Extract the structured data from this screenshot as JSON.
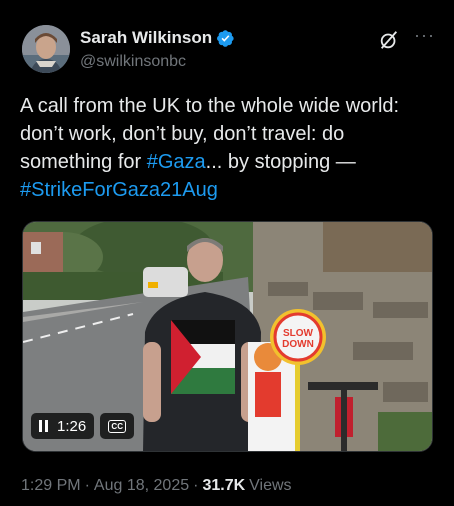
{
  "author": {
    "name": "Sarah Wilkinson",
    "handle": "@swilkinsonbc",
    "verified_color": "#1d9bf0"
  },
  "icons": {
    "grok": "grok-slash-icon",
    "more": "more-dots-icon"
  },
  "more_label": "···",
  "tweet": {
    "text_1": "A call from the UK to the whole wide world: don’t work, don’t buy, don’t travel: do something for ",
    "hashtag_1": "#Gaza",
    "text_2": "... by stopping — ",
    "hashtag_2": "#StrikeForGaza21Aug"
  },
  "video": {
    "elapsed": "1:26",
    "cc_label": "CC",
    "sign_text_1": "SLOW",
    "sign_text_2": "DOWN"
  },
  "meta": {
    "time": "1:29 PM",
    "sep": "·",
    "date": "Aug 18, 2025",
    "views_count": "31.7K",
    "views_label": "Views"
  },
  "colors": {
    "link": "#1d9bf0",
    "secondary": "#71767b",
    "primary_text": "#e7e9ea"
  }
}
